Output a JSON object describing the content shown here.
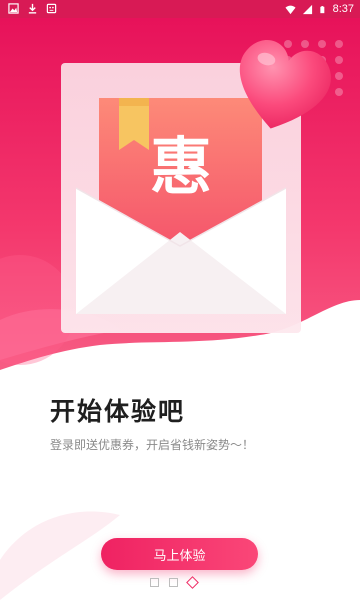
{
  "status_bar": {
    "time": "8:37",
    "left_icons": [
      "image-icon",
      "download-icon",
      "android-icon"
    ],
    "right_icons": [
      "wifi-icon",
      "signal-icon",
      "battery-icon"
    ]
  },
  "hero": {
    "badge_char": "惠",
    "accent": "#ef2262"
  },
  "content": {
    "title": "开始体验吧",
    "subtitle": "登录即送优惠券，开启省钱新姿势～！"
  },
  "cta": {
    "label": "马上体验"
  },
  "pager": {
    "count": 3,
    "active_index": 2
  }
}
